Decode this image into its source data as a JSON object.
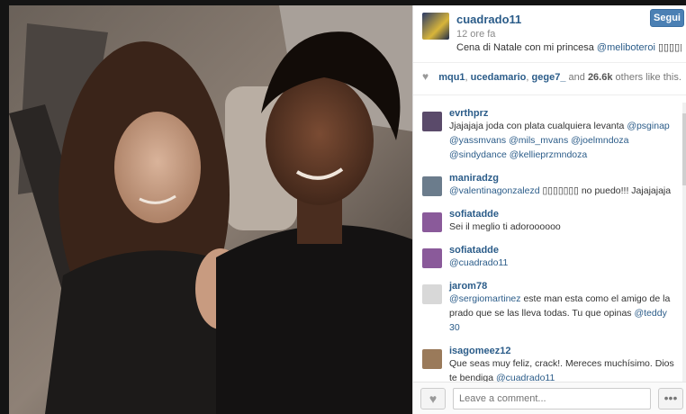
{
  "post": {
    "username": "cuadrado11",
    "time_ago": "12 ore fa",
    "follow_label": "Segui",
    "caption_text": "Cena di Natale con mi princesa",
    "caption_mention": "@meliboteroi",
    "caption_emoji": "▯▯▯▯▯"
  },
  "likes": {
    "users": [
      "mqu1",
      "ucedamario",
      "gege7_"
    ],
    "and_word": "and",
    "count": "26.6k",
    "suffix": "others like this."
  },
  "comments": [
    {
      "user": "evrthprz",
      "parts": [
        {
          "t": "Jjajajaja joda con plata cualquiera levanta "
        },
        {
          "m": "@psginap"
        },
        {
          "t": " "
        },
        {
          "m": "@yassmvans"
        },
        {
          "t": " "
        },
        {
          "m": "@mils_mvans"
        },
        {
          "t": " "
        },
        {
          "m": "@joelmndoza"
        },
        {
          "t": " "
        },
        {
          "m": "@sindydance"
        },
        {
          "t": " "
        },
        {
          "m": "@kellieprzmndoza"
        }
      ],
      "avatar": "#5a4a6a"
    },
    {
      "user": "maniradzg",
      "parts": [
        {
          "m": "@valentinagonzalezd"
        },
        {
          "t": " ▯▯▯▯▯▯▯ no puedo!!! Jajajajaja"
        }
      ],
      "avatar": "#6b7c8c"
    },
    {
      "user": "sofiatadde",
      "parts": [
        {
          "t": "Sei il meglio ti adoroooooo"
        }
      ],
      "avatar": "#8a5a9a"
    },
    {
      "user": "sofiatadde",
      "parts": [
        {
          "m": "@cuadrado11"
        }
      ],
      "avatar": "#8a5a9a"
    },
    {
      "user": "jarom78",
      "parts": [
        {
          "m": "@sergiomartinez"
        },
        {
          "t": " este man esta como el amigo de la prado que se las lleva todas. Tu que opinas "
        },
        {
          "m": "@teddy"
        },
        {
          "t": " "
        },
        {
          "n": "30"
        }
      ],
      "avatar": "#d8d8d8"
    },
    {
      "user": "isagomeez12",
      "parts": [
        {
          "t": "Que seas muy feliz, crack!. Mereces muchísimo. Dios te bendiga "
        },
        {
          "m": "@cuadrado11"
        }
      ],
      "avatar": "#9a7a5a"
    }
  ],
  "footer": {
    "comment_placeholder": "Leave a comment...",
    "like_icon": "heart-icon",
    "more_icon": "ellipsis-icon",
    "more_label": "•••",
    "heart_glyph": "♥"
  },
  "colors": {
    "link": "#2b5c89",
    "follow_button": "#4b80b4"
  }
}
